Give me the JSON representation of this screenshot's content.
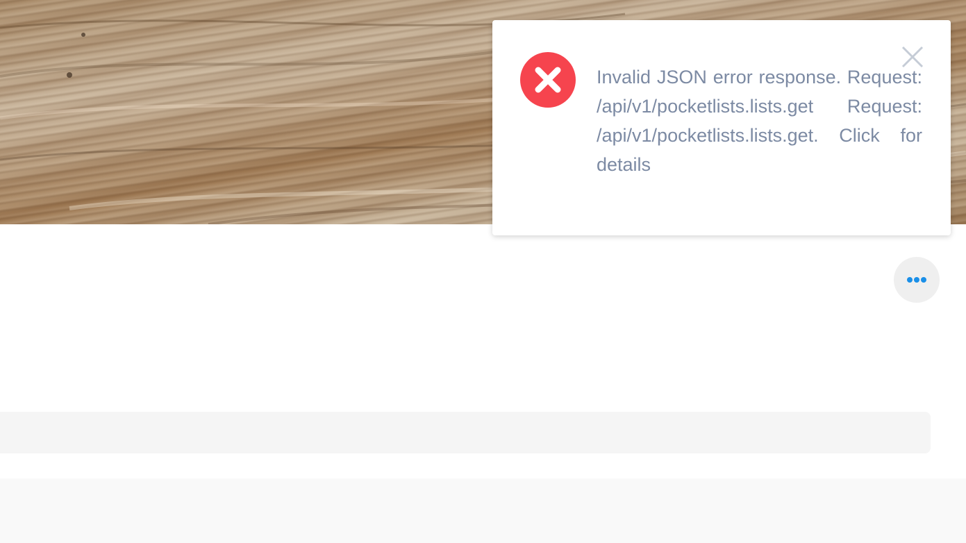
{
  "toast": {
    "message": "Invalid JSON error response. Request: /api/v1/pocketlists.lists.get Request: /api/v1/pocketlists.lists.get. Click for details",
    "type": "error",
    "icon": "error-x-icon",
    "close_icon": "close-icon",
    "colors": {
      "icon_bg": "#f6444e",
      "text": "#7c8aa3"
    }
  },
  "toolbar": {
    "more_icon": "more-dots-icon",
    "accent": "#1a8fe8"
  }
}
